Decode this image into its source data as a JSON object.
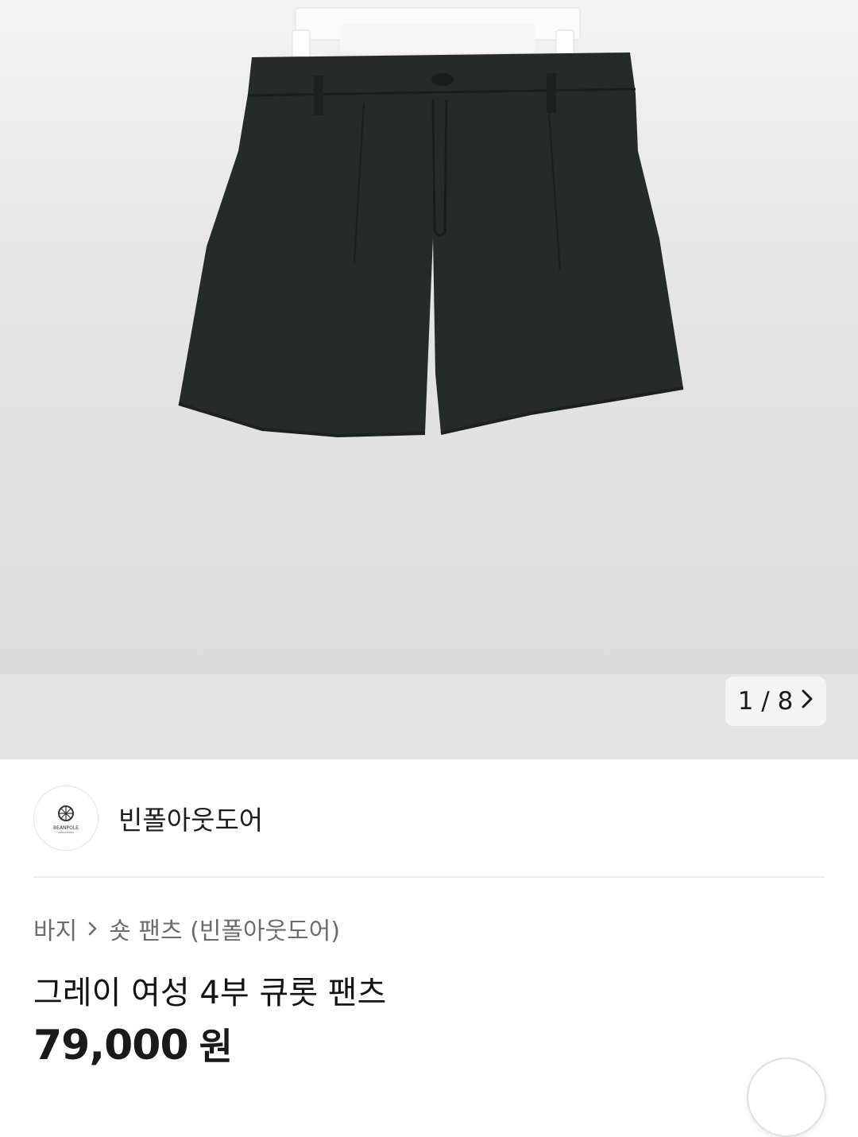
{
  "gallery": {
    "image_alt_icon": "product-photo-shorts",
    "counter": "1 / 8",
    "next_icon": "chevron-right-icon"
  },
  "seller": {
    "name": "빈폴아웃도어",
    "logo_text": "BEANPOLE"
  },
  "breadcrumb": {
    "category": "바지",
    "subcategory": "숏 팬츠 (빈폴아웃도어)"
  },
  "product": {
    "title": "그레이 여성 4부 큐롯 팬츠",
    "price": "79,000",
    "currency": "원"
  },
  "colors": {
    "image_bg": "#e4e4e6",
    "shorts": "#252a2b",
    "text_primary": "#141414",
    "text_secondary": "#6c6c6c"
  }
}
